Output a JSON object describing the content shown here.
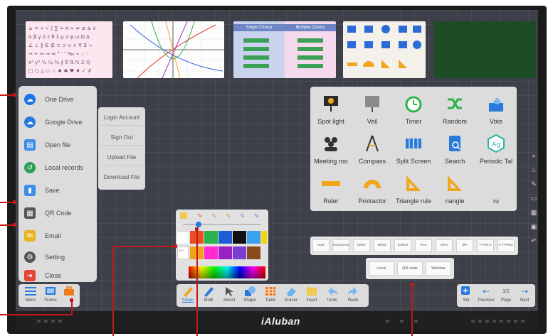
{
  "brand": "iAluban",
  "file_menu": {
    "items": [
      {
        "label": "One Drive",
        "icon": "onedrive-icon",
        "color": "#1a73e8"
      },
      {
        "label": "Google Drive",
        "icon": "cloud-icon",
        "color": "#2a7ad9"
      },
      {
        "label": "Open file",
        "icon": "open-file-icon",
        "color": "#3a8ee8"
      },
      {
        "label": "Local records",
        "icon": "history-icon",
        "color": "#2d9d5a"
      },
      {
        "label": "Save",
        "icon": "save-icon",
        "color": "#3a8ee8"
      },
      {
        "label": "QR Code",
        "icon": "qr-code-icon",
        "color": "#555555"
      },
      {
        "label": "Email",
        "icon": "email-icon",
        "color": "#e8b321"
      },
      {
        "label": "Setting",
        "icon": "settings-icon",
        "color": "#555555"
      },
      {
        "label": "Close",
        "icon": "close-icon",
        "color": "#e8453a"
      }
    ]
  },
  "account_menu": {
    "items": [
      "Login Account",
      "Sign Out",
      "Upload File",
      "Download File"
    ]
  },
  "tools": {
    "items": [
      {
        "label": "Spot light",
        "icon": "spotlight-icon"
      },
      {
        "label": "Veil",
        "icon": "veil-icon"
      },
      {
        "label": "Timer",
        "icon": "timer-icon"
      },
      {
        "label": "Random",
        "icon": "random-icon"
      },
      {
        "label": "Vote",
        "icon": "vote-icon"
      },
      {
        "label": "Meeting roo",
        "icon": "meeting-room-icon"
      },
      {
        "label": "Compass",
        "icon": "compass-icon"
      },
      {
        "label": "Split Screen",
        "icon": "split-screen-icon"
      },
      {
        "label": "Search",
        "icon": "search-icon"
      },
      {
        "label": "Periodic Tal",
        "icon": "periodic-table-icon"
      },
      {
        "label": "Ruler",
        "icon": "ruler-icon"
      },
      {
        "label": "Protractor",
        "icon": "protractor-icon"
      },
      {
        "label": "Triangle rule",
        "icon": "triangle-ruler-icon"
      },
      {
        "label": "riangle",
        "icon": "triangle-icon"
      },
      {
        "label": "ru",
        "icon": "ruler-partial-icon"
      }
    ]
  },
  "save_formats": {
    "row1": [
      "Note",
      "Document",
      "IDWT",
      "IDWC",
      "IDWGI",
      "VGA",
      "SPO",
      "3PI",
      "TYPE-C",
      "F TYPEC"
    ],
    "row2": [
      "Local",
      "QR code",
      "Window"
    ]
  },
  "palette": {
    "row1": [
      "#e8511f",
      "#2ab34a",
      "#1c5cd6",
      "#111111",
      "#3aa0f0",
      "#f5d410"
    ],
    "row2": [
      "#f2a11b",
      "#ff2ad2",
      "#9c1fc6",
      "#7a3fd0",
      "#8a4a1e"
    ],
    "labels": [
      "200",
      "200"
    ]
  },
  "left_toolbar": [
    {
      "label": "Menu",
      "icon": "menu-icon"
    },
    {
      "label": "Frame",
      "icon": "frame-icon"
    },
    {
      "label": "",
      "icon": "toolbox-icon"
    }
  ],
  "mid_toolbar": [
    {
      "label": "Single",
      "icon": "single-pen-icon"
    },
    {
      "label": "Multi",
      "icon": "multi-pen-icon"
    },
    {
      "label": "Select",
      "icon": "select-icon"
    },
    {
      "label": "Shape",
      "icon": "shape-icon"
    },
    {
      "label": "Table",
      "icon": "table-icon"
    },
    {
      "label": "Eraser",
      "icon": "eraser-icon"
    },
    {
      "label": "Insert",
      "icon": "insert-icon"
    },
    {
      "label": "Undo",
      "icon": "undo-icon"
    },
    {
      "label": "Redo",
      "icon": "redo-icon"
    }
  ],
  "right_toolbar": {
    "add_label": "Set",
    "prev_label": "Previous",
    "page_label": "Page",
    "page_value": "1/1",
    "next_label": "Next"
  },
  "thumbnails": {
    "slide3_left_title": "Single Choice",
    "slide3_right_title": "Multiple Choice"
  },
  "colors": {
    "accent_red": "#c41919",
    "board": "#3d4048"
  }
}
